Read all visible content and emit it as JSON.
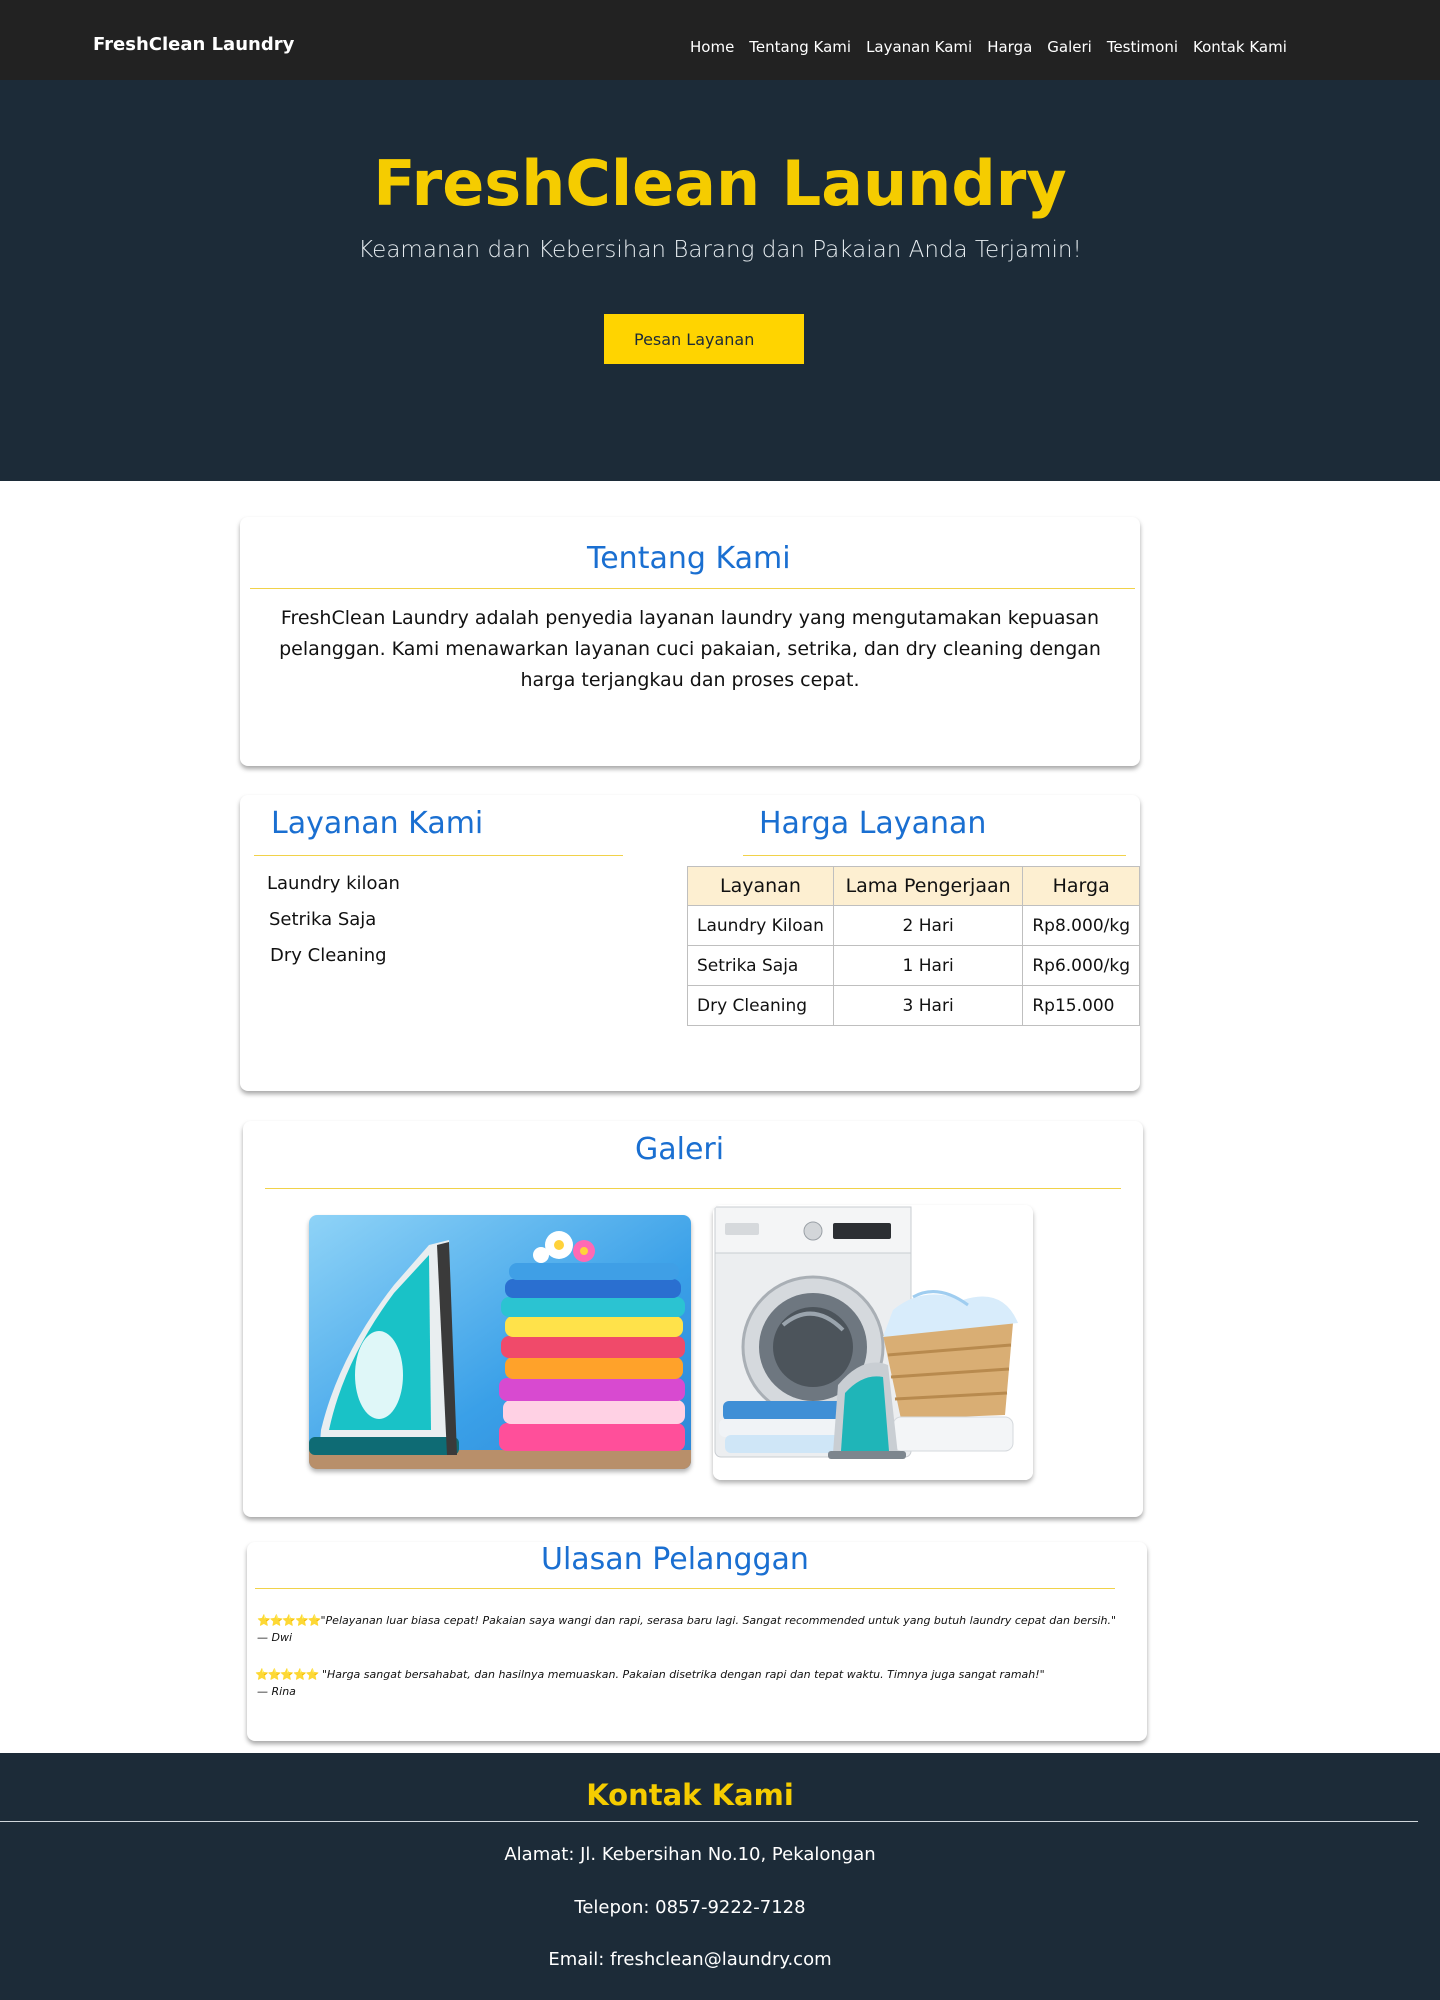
{
  "nav": {
    "brand": "FreshClean Laundry",
    "links": [
      "Home",
      "Tentang Kami",
      "Layanan Kami",
      "Harga",
      "Galeri",
      "Testimoni",
      "Kontak Kami"
    ]
  },
  "hero": {
    "title": "FreshClean Laundry",
    "subtitle": "Keamanan dan Kebersihan Barang dan Pakaian Anda Terjamin!",
    "button": "Pesan Layanan"
  },
  "about": {
    "title": "Tentang Kami",
    "text": "FreshClean Laundry adalah penyedia layanan laundry yang mengutamakan kepuasan pelanggan. Kami menawarkan layanan cuci pakaian, setrika, dan dry cleaning dengan harga terjangkau dan proses cepat."
  },
  "services": {
    "title": "Layanan Kami",
    "items": [
      "Laundry kiloan",
      "Setrika Saja",
      "Dry Cleaning"
    ]
  },
  "prices": {
    "title": "Harga Layanan",
    "headers": [
      "Layanan",
      "Lama Pengerjaan",
      "Harga"
    ],
    "rows": [
      [
        "Laundry Kiloan",
        "2 Hari",
        "Rp8.000/kg"
      ],
      [
        "Setrika Saja",
        "1 Hari",
        "Rp6.000/kg"
      ],
      [
        "Dry Cleaning",
        "3 Hari",
        "Rp15.000"
      ]
    ]
  },
  "gallery": {
    "title": "Galeri",
    "images": [
      "iron-and-folded-clothes-image",
      "washing-machine-and-laundry-image"
    ]
  },
  "reviews": {
    "title": "Ulasan Pelanggan",
    "items": [
      {
        "stars": "⭐⭐⭐⭐⭐",
        "text": "\"Pelayanan luar biasa cepat! Pakaian saya wangi dan rapi, serasa baru lagi. Sangat recommended untuk yang butuh laundry cepat dan bersih.\"",
        "author": "— Dwi"
      },
      {
        "stars": "⭐⭐⭐⭐⭐",
        "text": " \"Harga sangat bersahabat, dan hasilnya memuaskan. Pakaian disetrika dengan rapi dan tepat waktu. Timnya juga sangat ramah!\"",
        "author": "— Rina"
      }
    ]
  },
  "contact": {
    "title": "Kontak Kami",
    "address": "Alamat: Jl. Kebersihan No.10, Pekalongan",
    "phone": "Telepon: 0857-9222-7128",
    "email": "Email: freshclean@laundry.com"
  },
  "colors": {
    "nav_bg": "#222222",
    "hero_bg": "#1c2b38",
    "accent_yellow": "#ffd400",
    "heading_blue": "#1a6fd1",
    "table_header_bg": "#fdefd1"
  }
}
